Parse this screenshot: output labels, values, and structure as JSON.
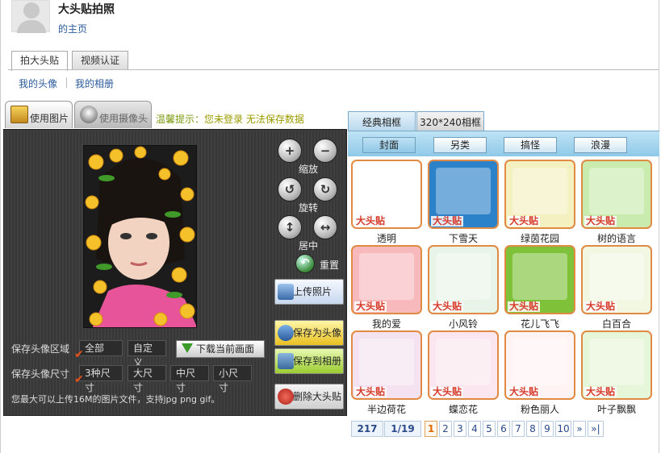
{
  "header": {
    "title": "大头贴拍照",
    "home_link": "的主页"
  },
  "tabs": [
    {
      "label": "拍大头贴",
      "active": true
    },
    {
      "label": "视频认证",
      "active": false
    }
  ],
  "sub_nav": [
    "我的头像",
    "我的相册"
  ],
  "mode_tabs": [
    {
      "label": "使用图片",
      "active": true
    },
    {
      "label": "使用摄像头",
      "active": false
    }
  ],
  "hint": {
    "prefix": "温馨提示：",
    "text": "您未登录 无法保存数据"
  },
  "controls": {
    "zoom": "缩放",
    "rotate": "旋转",
    "center": "居中",
    "reset": "重置"
  },
  "actions": {
    "upload": "上传照片",
    "save_avatar": "保存为头像",
    "save_album": "保存到相册",
    "delete": "删除大头贴"
  },
  "save_area": {
    "label": "保存头像区域",
    "options": [
      "全部",
      "自定义"
    ],
    "selected": "全部",
    "download": "下载当前画面"
  },
  "save_size": {
    "label": "保存头像尺寸",
    "options": [
      "3种尺寸",
      "大尺寸",
      "中尺寸",
      "小尺寸"
    ],
    "selected": "3种尺寸"
  },
  "note": "您最大可以上传16M的图片文件，支持jpg png gif。",
  "frame_tabs": [
    {
      "label": "经典相框",
      "active": true
    },
    {
      "label": "320*240相框",
      "active": false
    }
  ],
  "categories": [
    {
      "label": "封面",
      "active": true
    },
    {
      "label": "另类"
    },
    {
      "label": "搞怪"
    },
    {
      "label": "浪漫"
    }
  ],
  "frame_tag": "大头贴",
  "frames": [
    {
      "name": "透明",
      "bg": "#ffffff"
    },
    {
      "name": "下雪天",
      "bg": "#2b82c9"
    },
    {
      "name": "绿茵花园",
      "bg": "#f4f0c0"
    },
    {
      "name": "树的语言",
      "bg": "#c9ecae"
    },
    {
      "name": "我的爱",
      "bg": "#f8b9bd"
    },
    {
      "name": "小风铃",
      "bg": "#e8f4e8"
    },
    {
      "name": "花儿飞飞",
      "bg": "#7fc23a"
    },
    {
      "name": "白百合",
      "bg": "#f2f7e2"
    },
    {
      "name": "半边荷花",
      "bg": "#f4e2f0"
    },
    {
      "name": "蝶恋花",
      "bg": "#fbe6ef"
    },
    {
      "name": "粉色丽人",
      "bg": "#fff3f4"
    },
    {
      "name": "叶子飘飘",
      "bg": "#e6f6d8"
    }
  ],
  "pagination": {
    "total": "217",
    "page_info": "1/19",
    "current": "1",
    "pages": [
      "1",
      "2",
      "3",
      "4",
      "5",
      "6",
      "7",
      "8",
      "9",
      "10"
    ],
    "next": "»",
    "last": "»|"
  }
}
